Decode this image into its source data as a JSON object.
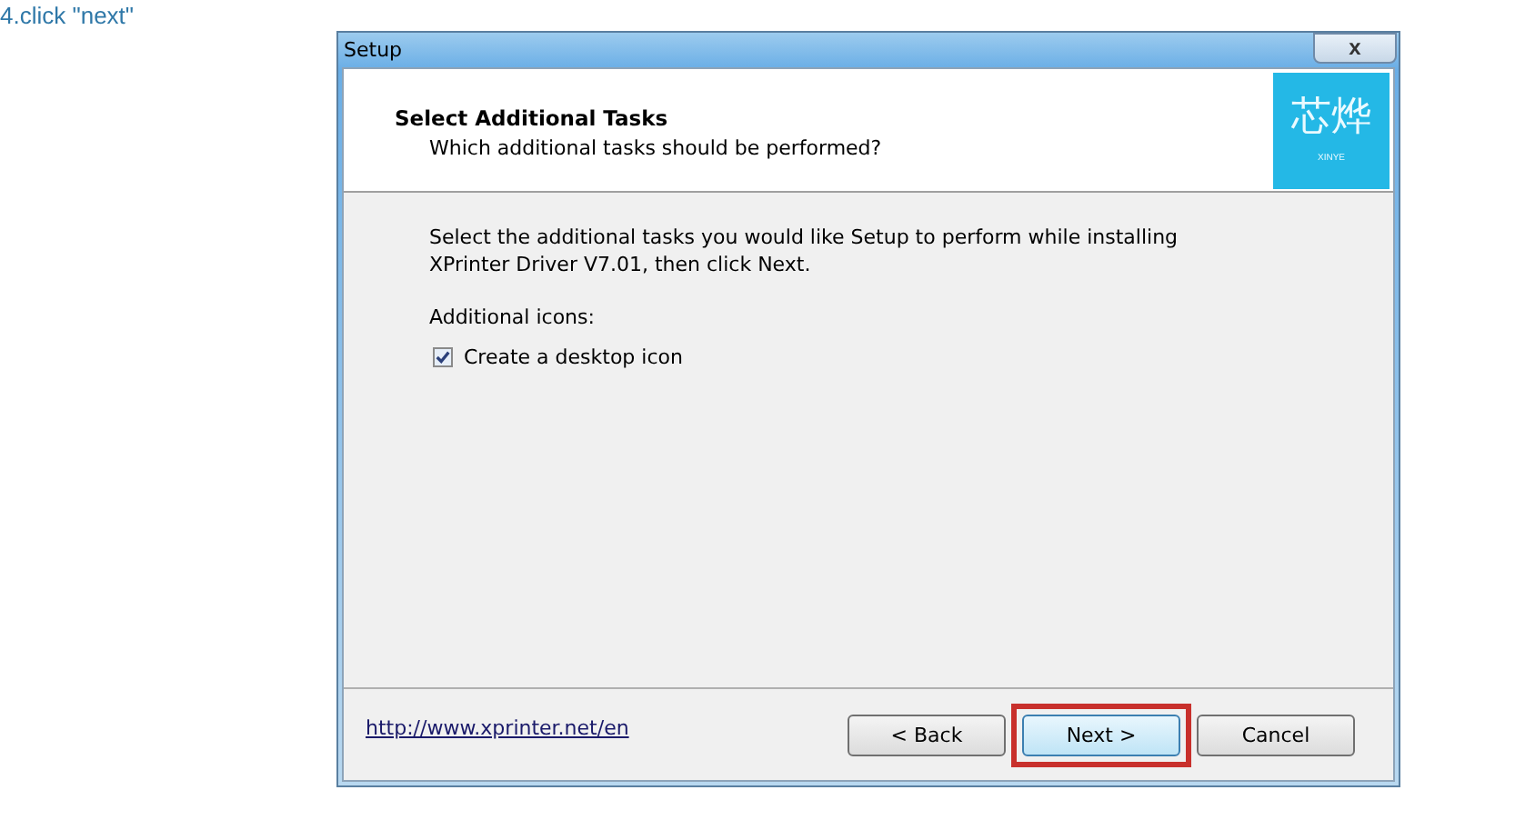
{
  "caption": "4.click \"next\"",
  "window": {
    "title": "Setup",
    "close": "x"
  },
  "header": {
    "title": "Select Additional Tasks",
    "subtitle": "Which additional tasks should be performed?",
    "logo": {
      "mark": "芯烨",
      "brand": "XINYE"
    }
  },
  "body": {
    "intro": "Select the additional tasks you would like Setup to perform while installing XPrinter Driver V7.01, then click Next.",
    "group_label": "Additional icons:",
    "tasks": [
      {
        "label": "Create a desktop icon",
        "checked": true
      }
    ]
  },
  "footer": {
    "link": "http://www.xprinter.net/en",
    "buttons": [
      {
        "label": "< Back",
        "default": false,
        "highlighted": false
      },
      {
        "label": "Next >",
        "default": true,
        "highlighted": true
      },
      {
        "label": "Cancel",
        "default": false,
        "highlighted": false
      }
    ]
  }
}
